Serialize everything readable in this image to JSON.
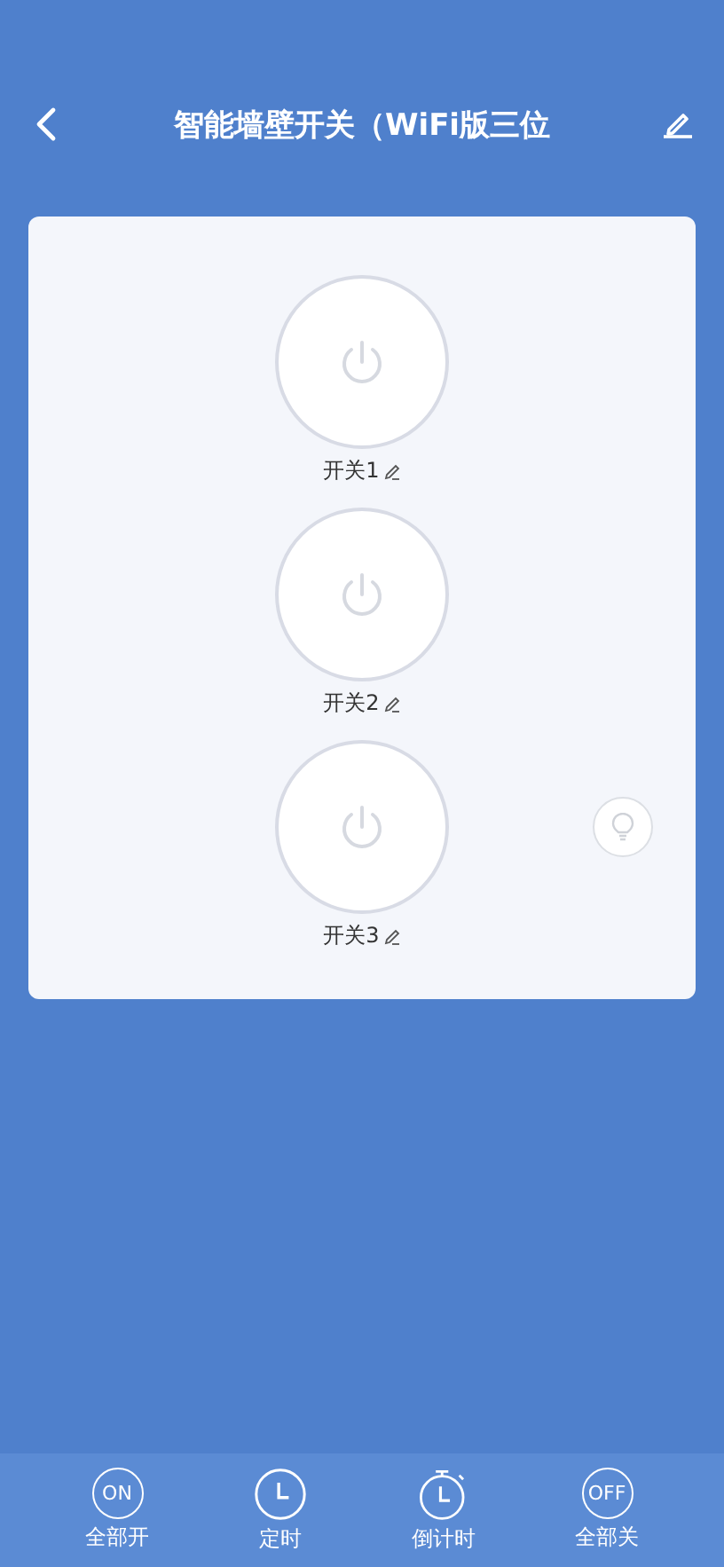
{
  "header": {
    "title": "智能墙壁开关（WiFi版三位"
  },
  "switches": [
    {
      "label": "开关1",
      "on": false
    },
    {
      "label": "开关2",
      "on": false
    },
    {
      "label": "开关3",
      "on": false
    }
  ],
  "bottom_bar": [
    {
      "kind": "all_on",
      "glyph": "ON",
      "label": "全部开"
    },
    {
      "kind": "timer",
      "label": "定时"
    },
    {
      "kind": "countdown",
      "label": "倒计时"
    },
    {
      "kind": "all_off",
      "glyph": "OFF",
      "label": "全部关"
    }
  ]
}
